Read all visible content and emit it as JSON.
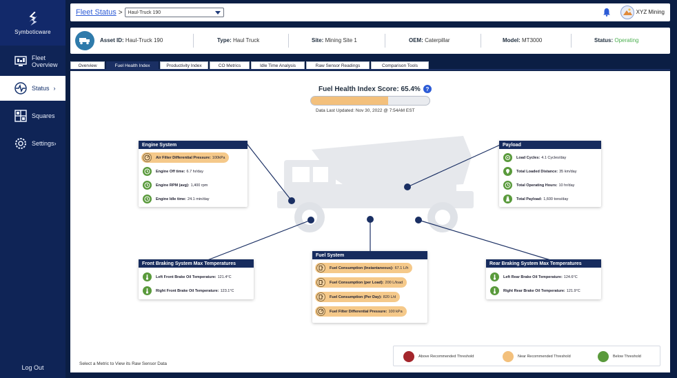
{
  "brand": {
    "name": "Symboticware"
  },
  "sidebar": {
    "items": [
      {
        "id": "fleet",
        "label_line1": "Fleet",
        "label_line2": "Overview",
        "icon": "fleet-overview-icon"
      },
      {
        "id": "status",
        "label": "Status",
        "chevron": "›",
        "icon": "pulse-icon"
      },
      {
        "id": "squares",
        "label": "Squares",
        "icon": "squares-icon"
      },
      {
        "id": "settings",
        "label": "Settings",
        "chevron": "›",
        "icon": "gear-icon"
      }
    ],
    "logout": "Log Out"
  },
  "header": {
    "breadcrumb_link": "Fleet Status",
    "breadcrumb_sep": ">",
    "asset_select_value": "Haul-Truck 190",
    "org_name": "XYZ Mining"
  },
  "asset": {
    "id_label": "Asset ID:",
    "id_value": "Haul-Truck 190",
    "type_label": "Type:",
    "type_value": "Haul Truck",
    "site_label": "Site:",
    "site_value": "Mining Site 1",
    "oem_label": "OEM:",
    "oem_value": "Caterpillar",
    "model_label": "Model:",
    "model_value": "MT3000",
    "status_label": "Status:",
    "status_value": "Operating"
  },
  "tabs": [
    {
      "label": "Overview",
      "active": false
    },
    {
      "label": "Fuel Health Index",
      "active": true
    },
    {
      "label": "Productivity Index",
      "active": false
    },
    {
      "label": "CO Metrics",
      "active": false
    },
    {
      "label": "Idle Time Analysis",
      "active": false
    },
    {
      "label": "Raw Sensor Readings",
      "active": false
    },
    {
      "label": "Comparison Tools",
      "active": false
    }
  ],
  "score": {
    "title": "Fuel Health Index Score: 65.4%",
    "value_fraction": 0.654,
    "help": "?",
    "updated": "Data Last Updated: Nov 30, 2022 @ 7:54AM EST"
  },
  "cards": {
    "engine": {
      "title": "Engine System",
      "metrics": [
        {
          "name": "Air Filter Differential Pressure:",
          "value": "100kPa",
          "state": "near"
        },
        {
          "name": "Engine Off time:",
          "value": "6.7 hr/day",
          "state": "below"
        },
        {
          "name": "Engine RPM (avg):",
          "value": "1,400 rpm",
          "state": "below"
        },
        {
          "name": "Engine Idle time:",
          "value": "24.1 min/day",
          "state": "below"
        }
      ]
    },
    "payload": {
      "title": "Payload",
      "metrics": [
        {
          "name": "Load Cycles:",
          "value": "4.1 Cycles/day",
          "state": "below"
        },
        {
          "name": "Total Loaded Distance:",
          "value": "35 km/day",
          "state": "below"
        },
        {
          "name": "Total Operating Hours:",
          "value": "10 hr/day",
          "state": "below"
        },
        {
          "name": "Total Payload:",
          "value": "1,600 tons/day",
          "state": "below"
        }
      ]
    },
    "front_brake": {
      "title": "Front Braking System Max Temperatures",
      "metrics": [
        {
          "name": "Left Front Brake Oil Temperature:",
          "value": "121.4°C",
          "state": "below"
        },
        {
          "name": "Right Front Brake Oil Temperature:",
          "value": "123.1°C",
          "state": "below"
        }
      ]
    },
    "fuel": {
      "title": "Fuel System",
      "metrics": [
        {
          "name": "Fuel Consumption (Instantaneous):",
          "value": "67.1 L/h",
          "state": "near"
        },
        {
          "name": "Fuel Consumption (per Load):",
          "value": "200 L/load",
          "state": "near"
        },
        {
          "name": "Fuel Consumption (Per Day):",
          "value": "820 L/d",
          "state": "near"
        },
        {
          "name": "Fuel Filter Differential Pressure:",
          "value": "100 kPa",
          "state": "near"
        }
      ]
    },
    "rear_brake": {
      "title": "Rear Braking System Max Temperatures",
      "metrics": [
        {
          "name": "Left Rear Brake Oil Temperature:",
          "value": "124.6°C",
          "state": "below"
        },
        {
          "name": "Right Rear Brake Oil Temperature:",
          "value": "121.9°C",
          "state": "below"
        }
      ]
    }
  },
  "hint": "Select a Metric to View its Raw Sensor Data",
  "legend": [
    {
      "label": "Above Recommended Threshold",
      "color": "#a4262c"
    },
    {
      "label": "Near Recommended Threshold",
      "color": "#f3c07c"
    },
    {
      "label": "Below Threshold",
      "color": "#5a9a3c"
    }
  ],
  "colors": {
    "navy": "#172c5e",
    "accent_blue": "#2c5bd6",
    "status_green": "#4caf50"
  }
}
